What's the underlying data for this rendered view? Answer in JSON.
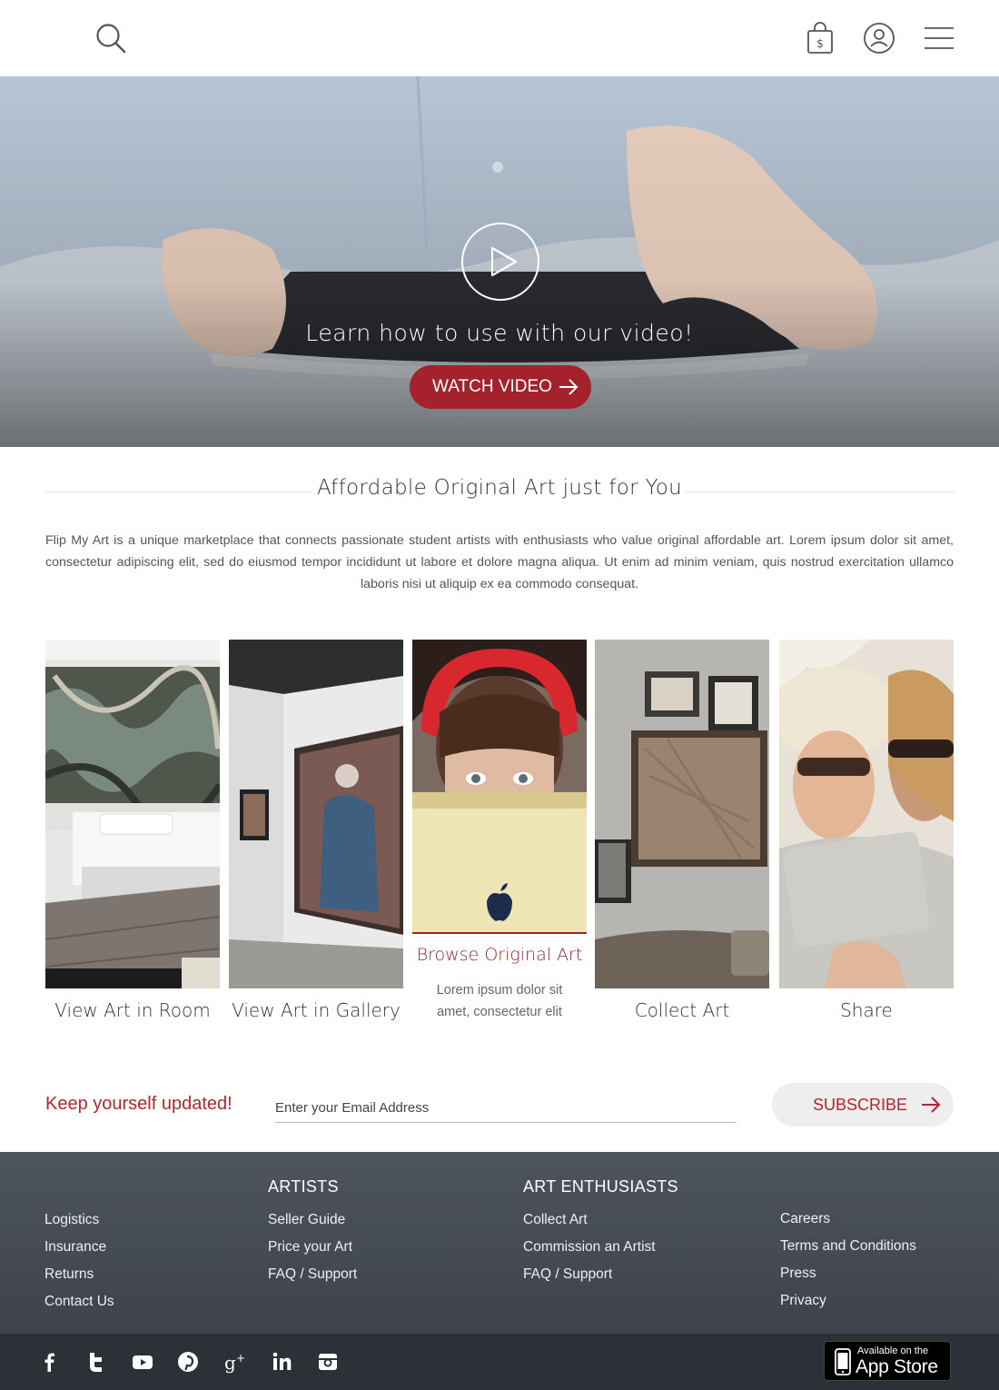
{
  "header": {
    "icons": [
      "search-icon",
      "shopping-bag-icon",
      "user-icon",
      "menu-icon"
    ]
  },
  "hero": {
    "tagline": "Learn how to use with our video!",
    "watch_label": "WATCH VIDEO"
  },
  "intro": {
    "title": "Affordable Original Art just for You",
    "body": "Flip My Art is a unique marketplace that connects passionate student artists with enthusiasts who value original affordable art. Lorem ipsum dolor sit amet, consectetur adipiscing elit, sed do eiusmod tempor incididunt ut labore et dolore magna aliqua. Ut enim ad minim veniam, quis nostrud exercitation ullamco laboris nisi ut aliquip ex ea commodo consequat."
  },
  "features": [
    {
      "label": "View Art in Room"
    },
    {
      "label": "View Art in Gallery"
    },
    {
      "label": "Browse Original Art",
      "desc": "Lorem ipsum dolor sit amet, consectetur elit"
    },
    {
      "label": "Collect Art"
    },
    {
      "label": "Share"
    }
  ],
  "newsletter": {
    "title": "Keep yourself updated!",
    "placeholder": "Enter your Email Address",
    "subscribe_label": "SUBSCRIBE"
  },
  "footer": {
    "col1": {
      "links": [
        "Logistics",
        "Insurance",
        "Returns",
        "Contact Us"
      ]
    },
    "col2": {
      "heading": "ARTISTS",
      "links": [
        "Seller Guide",
        "Price your Art",
        "FAQ / Support"
      ]
    },
    "col3": {
      "heading": "ART ENTHUSIASTS",
      "links": [
        "Collect Art",
        "Commission an Artist",
        "FAQ / Support"
      ]
    },
    "col4": {
      "links": [
        "Careers",
        "Terms and Conditions",
        "Press",
        "Privacy"
      ]
    }
  },
  "subfooter": {
    "social": [
      "facebook-icon",
      "twitter-icon",
      "youtube-icon",
      "pinterest-icon",
      "google-plus-icon",
      "linkedin-icon",
      "instagram-icon"
    ],
    "appstore_small": "Available on the",
    "appstore_big": "App Store"
  },
  "colors": {
    "accent": "#a5222c",
    "footer": "#474c54",
    "subfooter": "#2c3037"
  }
}
